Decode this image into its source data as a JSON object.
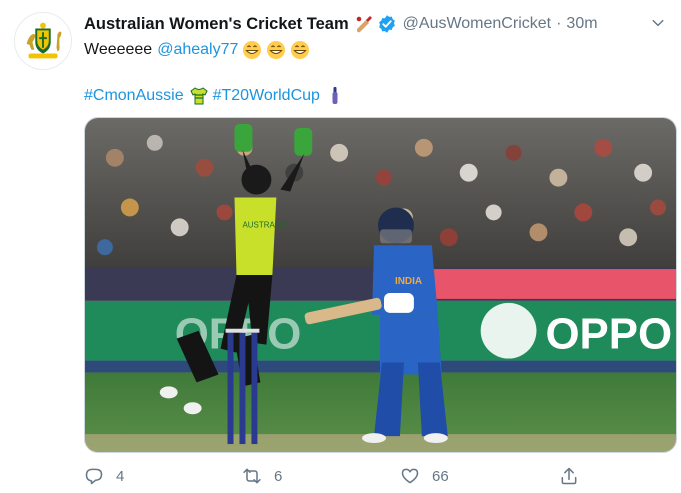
{
  "tweet": {
    "display_name": "Australian Women's Cricket Team",
    "handle": "@AusWomenCricket",
    "separator": "·",
    "time": "30m",
    "text_start": "Weeeeee",
    "mention": "@ahealy77",
    "hashtag_1": "#CmonAussie",
    "hashtag_2": "#T20WorldCup",
    "media_banner_text": "OPPO",
    "media_banner_text_2": "INDIA",
    "media_shirt_text": "AUSTRALIA"
  },
  "icons": {
    "avatar": "cricket-australia-logo",
    "bat_emoji": "cricket-bat-emoji",
    "verified": "verified-badge-icon",
    "caret": "chevron-down-icon",
    "grin": "grinning-face-emoji",
    "jersey": "australia-jersey-emoji",
    "bat_small": "cricket-bat-emoji",
    "reply": "reply-icon",
    "retweet": "retweet-icon",
    "like": "heart-icon",
    "share": "share-icon"
  },
  "actions": {
    "reply_count": "4",
    "retweet_count": "6",
    "like_count": "66"
  },
  "colors": {
    "link": "#1b95e0",
    "secondary": "#657786",
    "verified": "#1da1f2",
    "australia_yellow": "#c8e02a",
    "india_blue": "#2a64c4"
  }
}
